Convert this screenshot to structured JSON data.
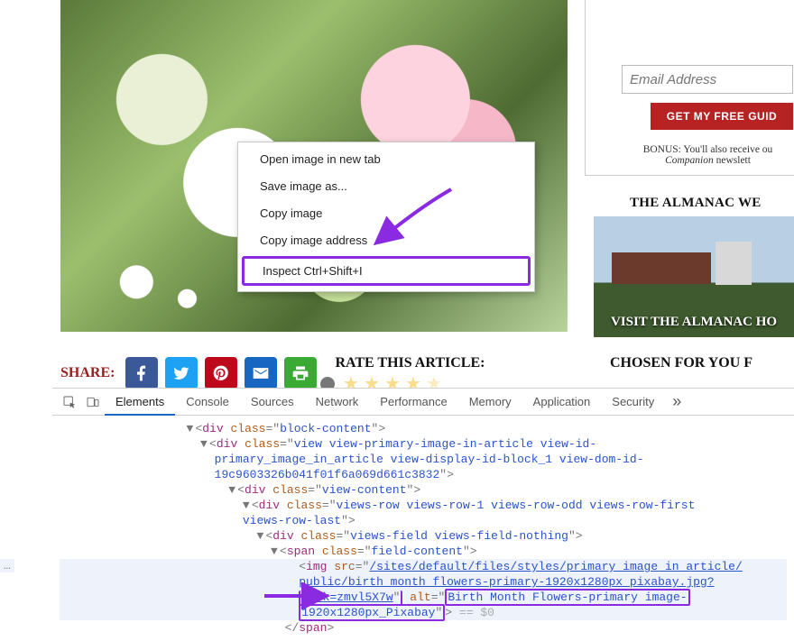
{
  "context_menu": {
    "items": [
      {
        "label": "Open image in new tab"
      },
      {
        "label": "Save image as..."
      },
      {
        "label": "Copy image"
      },
      {
        "label": "Copy image address"
      }
    ],
    "inspect_label": "Inspect",
    "inspect_shortcut": "Ctrl+Shift+I"
  },
  "sidebar": {
    "email_placeholder": "Email Address",
    "guide_btn": "GET MY FREE GUID",
    "bonus_prefix": "BONUS:",
    "bonus_text": " You'll also receive ou",
    "bonus_line2_italic": "Companion",
    "bonus_line2_rest": " newslett",
    "webcam_heading": "THE ALMANAC WE",
    "webcam_overlay": "VISIT THE ALMANAC HO",
    "chosen_heading": "CHOSEN FOR YOU F"
  },
  "share": {
    "label": "SHARE:",
    "rate_label": "RATE THIS ARTICLE:"
  },
  "devtools": {
    "tabs": [
      "Elements",
      "Console",
      "Sources",
      "Network",
      "Performance",
      "Memory",
      "Application",
      "Security"
    ],
    "more_glyph": "»",
    "dom": {
      "l1_class": "block-content",
      "l2_class": "view view-primary-image-in-article view-id-primary_image_in_article view-display-id-block_1 view-dom-id-19c9603326b041f01f6a069d661c3832",
      "l3_class": "view-content",
      "l4_class": "views-row views-row-1 views-row-odd views-row-first views-row-last",
      "l5_class": "views-field views-field-nothing",
      "l6_class": "field-content",
      "img_src": "/sites/default/files/styles/primary_image_in_article/public/birth_month_flowers-primary-1920x1280px_pixabay.jpg?itok=zmvl5X7w",
      "img_alt": "Birth Month Flowers-primary image-1920x1280px_Pixabay",
      "selected_hint": " == $0",
      "close_span": "</span>"
    }
  }
}
